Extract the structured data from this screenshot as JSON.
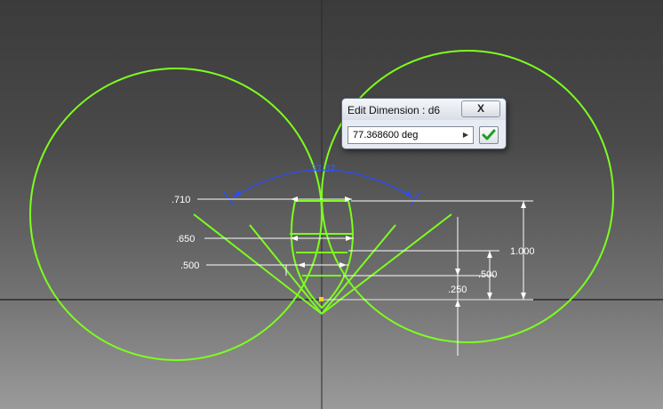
{
  "dialog": {
    "title": "Edit Dimension : d6",
    "close_label": "X",
    "value": "77.368600 deg"
  },
  "sketch": {
    "angle_label": "77.37",
    "dims_left": [
      ".710",
      ".650",
      ".500"
    ],
    "dims_right": [
      "1.000",
      ".500",
      ".250"
    ]
  },
  "colors": {
    "sketch_green": "#7cff1e",
    "angle_blue": "#2a4cff",
    "dim_white": "#ffffff",
    "accept_green": "#1f9d1f"
  }
}
